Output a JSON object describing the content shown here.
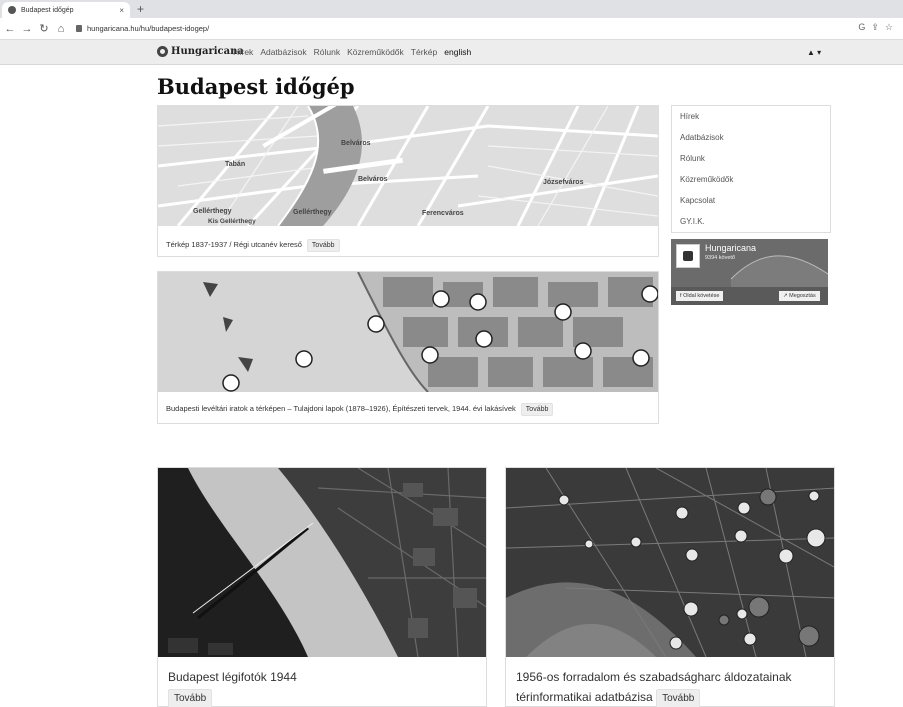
{
  "browser": {
    "tab_title": "Budapest időgép",
    "tab_close": "×",
    "new_tab": "+",
    "url": "hungaricana.hu/hu/budapest-idogep/"
  },
  "site": {
    "brand": "Hungaricana",
    "nav": [
      "Hírek",
      "Adatbázisok",
      "Rólunk",
      "Közreműködők",
      "Térkép",
      "english"
    ],
    "user_menu": "▲ ▾"
  },
  "page": {
    "title": "Budapest időgép"
  },
  "cards": {
    "map": {
      "caption": "Térkép 1837-1937 / Régi utcanév kereső",
      "more": "Tovább",
      "map_labels": [
        "Belváros",
        "Tabán",
        "Belváros",
        "Józsefváros",
        "Gellérthegy",
        "Gellérthegy",
        "Ferencváros",
        "Kis Gellérthegy"
      ]
    },
    "archive": {
      "caption": "Budapesti levéltári iratok a térképen – Tulajdoni lapok (1878–1926), Építészeti tervek, 1944. évi lakásívek",
      "more": "Tovább"
    },
    "aerial": {
      "caption": "Budapest légifotók 1944",
      "more": "Tovább"
    },
    "revolution": {
      "caption": "1956-os forradalom és szabadságharc áldozatainak térinformatikai adatbázisa",
      "more": "Tovább"
    }
  },
  "sidebar": {
    "items": [
      "Hírek",
      "Adatbázisok",
      "Rólunk",
      "Közreműködők",
      "Kapcsolat",
      "GY.I.K."
    ]
  },
  "facebook": {
    "name": "Hungaricana",
    "followers": "9394 követő",
    "follow_label": "Oldal követése",
    "share_label": "Megosztás"
  }
}
